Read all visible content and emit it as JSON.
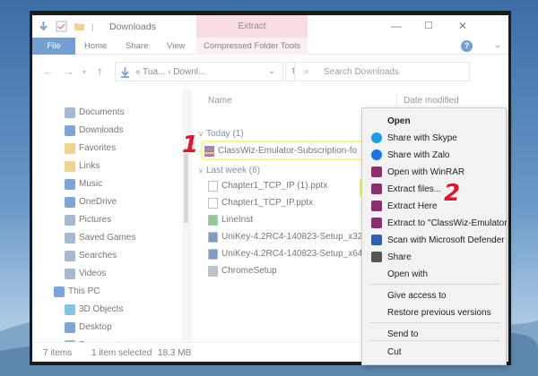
{
  "titlebar": {
    "title": "Downloads",
    "extract_tab": "Extract"
  },
  "window_buttons": {
    "minimize": "—",
    "maximize": "☐",
    "close": "✕"
  },
  "ribbon": {
    "file": "File",
    "home": "Home",
    "share": "Share",
    "view": "View",
    "compressed": "Compressed Folder Tools",
    "chevron": "⌄",
    "help": "?"
  },
  "navbar": {
    "back": "←",
    "forward": "→",
    "dropdown": "▾",
    "up": "↑",
    "address": "« Tua... › Downl...",
    "address_chevron": "⌄",
    "refresh": "↻",
    "search_placeholder": "Search Downloads"
  },
  "sidebar": {
    "items": [
      {
        "label": "Documents",
        "icon": "document-icon",
        "color": "#6d8fb8"
      },
      {
        "label": "Downloads",
        "icon": "download-icon",
        "color": "#2b6cc4"
      },
      {
        "label": "Favorites",
        "icon": "favorites-icon",
        "color": "#e8b84a"
      },
      {
        "label": "Links",
        "icon": "link-icon",
        "color": "#e8b84a"
      },
      {
        "label": "Music",
        "icon": "music-icon",
        "color": "#2b6cc4"
      },
      {
        "label": "OneDrive",
        "icon": "cloud-icon",
        "color": "#2b6cc4"
      },
      {
        "label": "Pictures",
        "icon": "pictures-icon",
        "color": "#6d8fb8"
      },
      {
        "label": "Saved Games",
        "icon": "saved-games-icon",
        "color": "#6d8fb8"
      },
      {
        "label": "Searches",
        "icon": "searches-icon",
        "color": "#6d8fb8"
      },
      {
        "label": "Videos",
        "icon": "videos-icon",
        "color": "#6d8fb8"
      },
      {
        "label": "This PC",
        "icon": "pc-icon",
        "color": "#2b6cc4"
      },
      {
        "label": "3D Objects",
        "icon": "objects-3d-icon",
        "color": "#3aa0d8"
      },
      {
        "label": "Desktop",
        "icon": "desktop-icon",
        "color": "#2b6cc4"
      },
      {
        "label": "Documents",
        "icon": "document-icon",
        "color": "#6d8fb8"
      }
    ]
  },
  "content": {
    "col_name": "Name",
    "col_date": "Date modified",
    "today": "Today (1)",
    "last_week": "Last week (6)",
    "files_today": [
      "ClassWiz-Emulator-Subscription-fo"
    ],
    "files_last_week": [
      "Chapter1_TCP_IP (1).pptx",
      "Chapter1_TCP_IP.pptx",
      "LineInst",
      "UniKey-4.2RC4-140823-Setup_x32",
      "UniKey-4.2RC4-140823-Setup_x64",
      "ChromeSetup"
    ],
    "hscroll_left": "<"
  },
  "status": {
    "items": "7 items",
    "selected": "1 item selected",
    "size": "18.3 MB"
  },
  "context_menu": {
    "items": [
      {
        "label": "Open",
        "icon": "",
        "bold": true
      },
      {
        "label": "Share with Skype",
        "icon": "skype-icon"
      },
      {
        "label": "Share with Zalo",
        "icon": "zalo-icon"
      },
      {
        "label": "Open with WinRAR",
        "icon": "winrar-icon"
      },
      {
        "label": "Extract files...",
        "icon": "winrar-icon"
      },
      {
        "label": "Extract Here",
        "icon": "winrar-icon"
      },
      {
        "label": "Extract to \"ClassWiz-Emulator",
        "icon": "winrar-icon"
      },
      {
        "label": "Scan with Microsoft Defender",
        "icon": "defender-icon"
      },
      {
        "label": "Share",
        "icon": "share-icon"
      },
      {
        "label": "Open with",
        "icon": ""
      },
      {
        "label": "Give access to",
        "icon": ""
      },
      {
        "label": "Restore previous versions",
        "icon": ""
      },
      {
        "label": "Send to",
        "icon": ""
      },
      {
        "label": "Cut",
        "icon": ""
      }
    ]
  },
  "steps": {
    "one": "1",
    "two": "2"
  },
  "colors": {
    "accent": "#1f66b5",
    "highlight": "#f2f53d",
    "step": "#e8102a",
    "extract_tab": "#f6c9d2"
  }
}
